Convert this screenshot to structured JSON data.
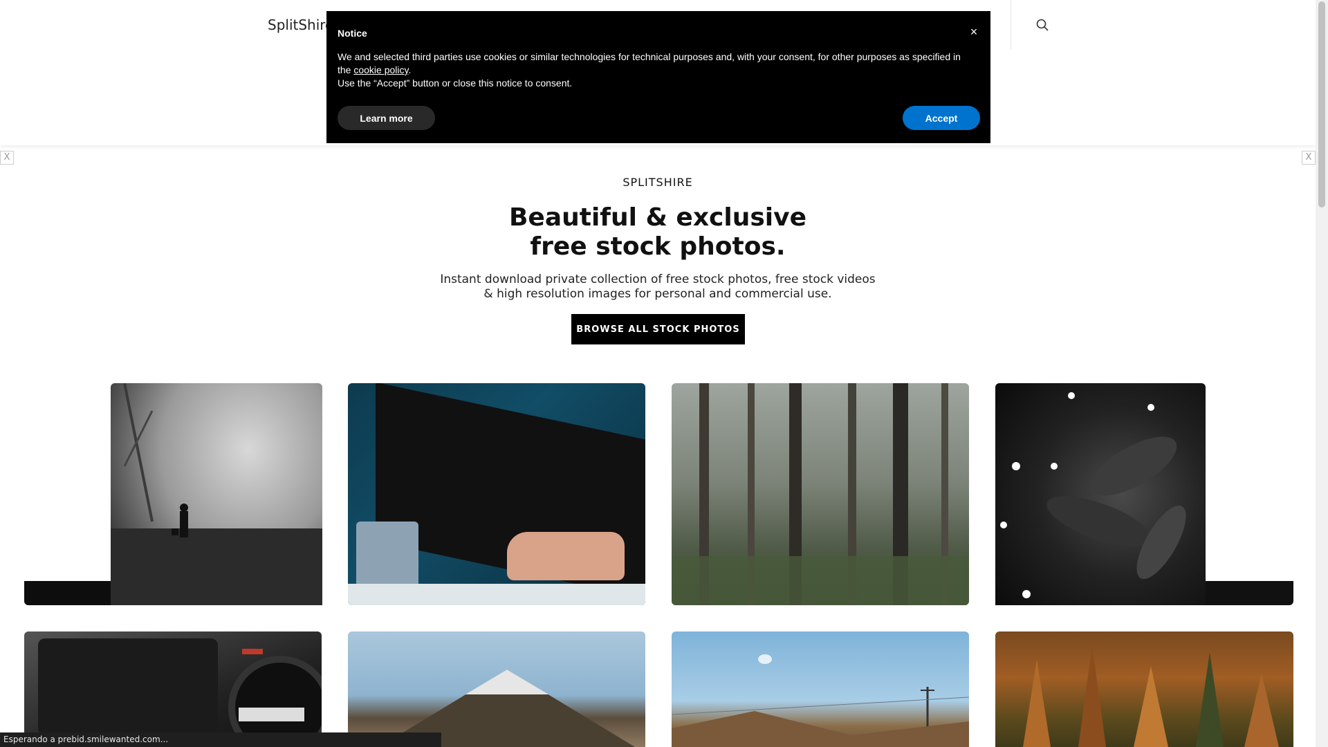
{
  "header": {
    "logo": "SplitShire",
    "search_icon": "search-icon"
  },
  "ads": {
    "close_left": "X",
    "close_right": "X"
  },
  "hero": {
    "eyebrow": "SPLITSHIRE",
    "title_line1": "Beautiful & exclusive",
    "title_line2": "free stock photos.",
    "subtitle_line1": "Instant download private collection of free stock photos, free stock videos",
    "subtitle_line2": "& high resolution images for personal and commercial use.",
    "cta_label": "BROWSE ALL STOCK PHOTOS"
  },
  "photos": [
    {
      "subject": "foggy street with person walking dog"
    },
    {
      "subject": "laptop with code and mug"
    },
    {
      "subject": "misty forest"
    },
    {
      "subject": "dark leaves with white flowers"
    },
    {
      "subject": "black off-road vehicle"
    },
    {
      "subject": "snowy mountain"
    },
    {
      "subject": "hillside with power pylon"
    },
    {
      "subject": "autumn larch forest"
    }
  ],
  "notice": {
    "title": "Notice",
    "close_label": "×",
    "text_before_link": "We and selected third parties use cookies or similar technologies for technical purposes and, with your consent, for other purposes as specified in the ",
    "link_text": "cookie policy",
    "text_after_link": ".",
    "text_line2": "Use the “Accept” button or close this notice to consent.",
    "learn_more_label": "Learn more",
    "accept_label": "Accept",
    "accept_color": "#0073ce"
  },
  "statusbar": {
    "text": "Esperando a prebid.smilewanted.com..."
  }
}
